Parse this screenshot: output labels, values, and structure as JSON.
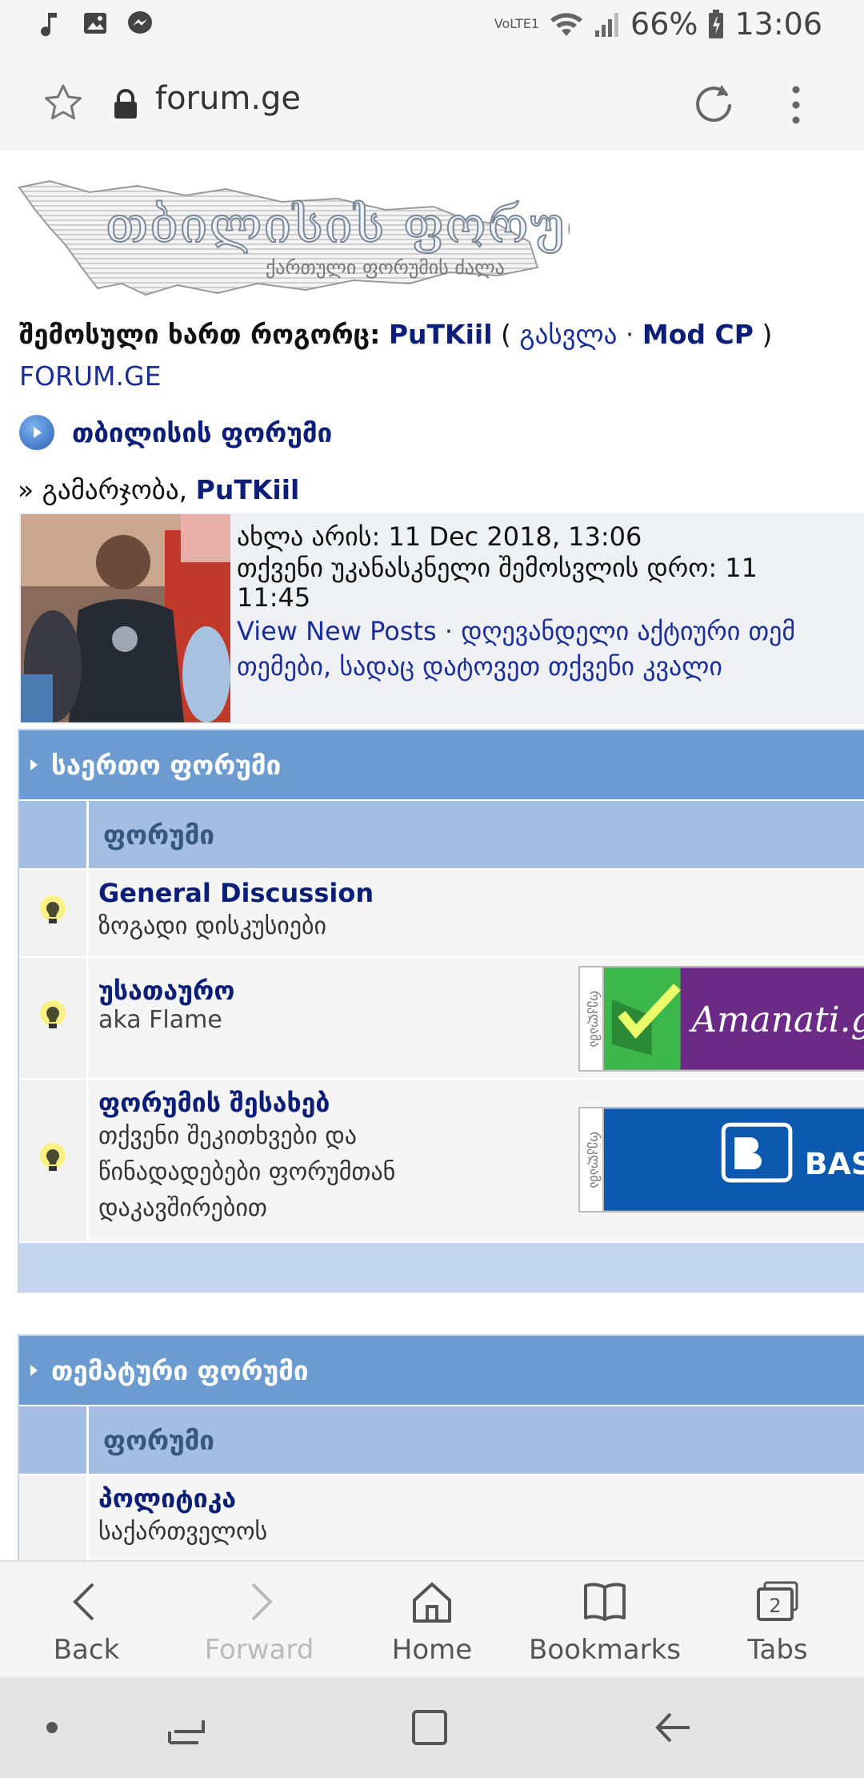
{
  "status_bar": {
    "battery": "66%",
    "time": "13:06",
    "network": "VoLTE1"
  },
  "browser": {
    "url": "forum.ge"
  },
  "page": {
    "logo_title": "თბილისის ფორუმი",
    "logo_subtitle": "ქართული ფორუმის ძალა",
    "login": {
      "prefix": "შემოსული ხართ როგორც:",
      "username": "PuTKiil",
      "logout": "გასვლა",
      "modcp": "Mod CP"
    },
    "site_link": "FORUM.GE",
    "nav_title": "თბილისის ფორუმი",
    "greeting": {
      "prefix": "» გამარჯობა,",
      "username": "PuTKiil"
    },
    "welcome": {
      "now": "ახლა არის: 11 Dec 2018, 13:06",
      "last_visit_1": "თქვენი უკანასკნელი შემოსვლის დრო: 11",
      "last_visit_2": "11:45",
      "view_new": "View New Posts",
      "today_active": "დღევანდელი აქტიური თემ",
      "my_topics": "თემები, სადაც დატოვეთ თქვენი კვალი"
    },
    "categories": [
      {
        "title": "საერთო ფორუმი",
        "column": "ფორუმი",
        "forums": [
          {
            "title": "General Discussion",
            "desc": "ზოგადი დისკუსიები"
          },
          {
            "title": "უსათაურო",
            "desc": "aka Flame",
            "ad": "Amanati.ge"
          },
          {
            "title": "ფორუმის შესახებ",
            "desc_lines": [
              "თქვენი შეკითხვები და",
              "წინადადებები ფორუმთან",
              "დაკავშირებით"
            ],
            "ad": "BASIS"
          }
        ]
      },
      {
        "title": "თემატური ფორუმი",
        "column": "ფორუმი",
        "forums": [
          {
            "title": "პოლიტიკა",
            "desc": "საქართველოს"
          }
        ]
      }
    ],
    "ad_side_label": "რეკლამა"
  },
  "bottom_bar": {
    "back": "Back",
    "forward": "Forward",
    "home": "Home",
    "bookmarks": "Bookmarks",
    "tabs": "Tabs",
    "tabs_count": "2"
  },
  "colors": {
    "category_header": "#6b9bd1",
    "column_header": "#a3bde3",
    "link_navy": "#0b1e78"
  }
}
